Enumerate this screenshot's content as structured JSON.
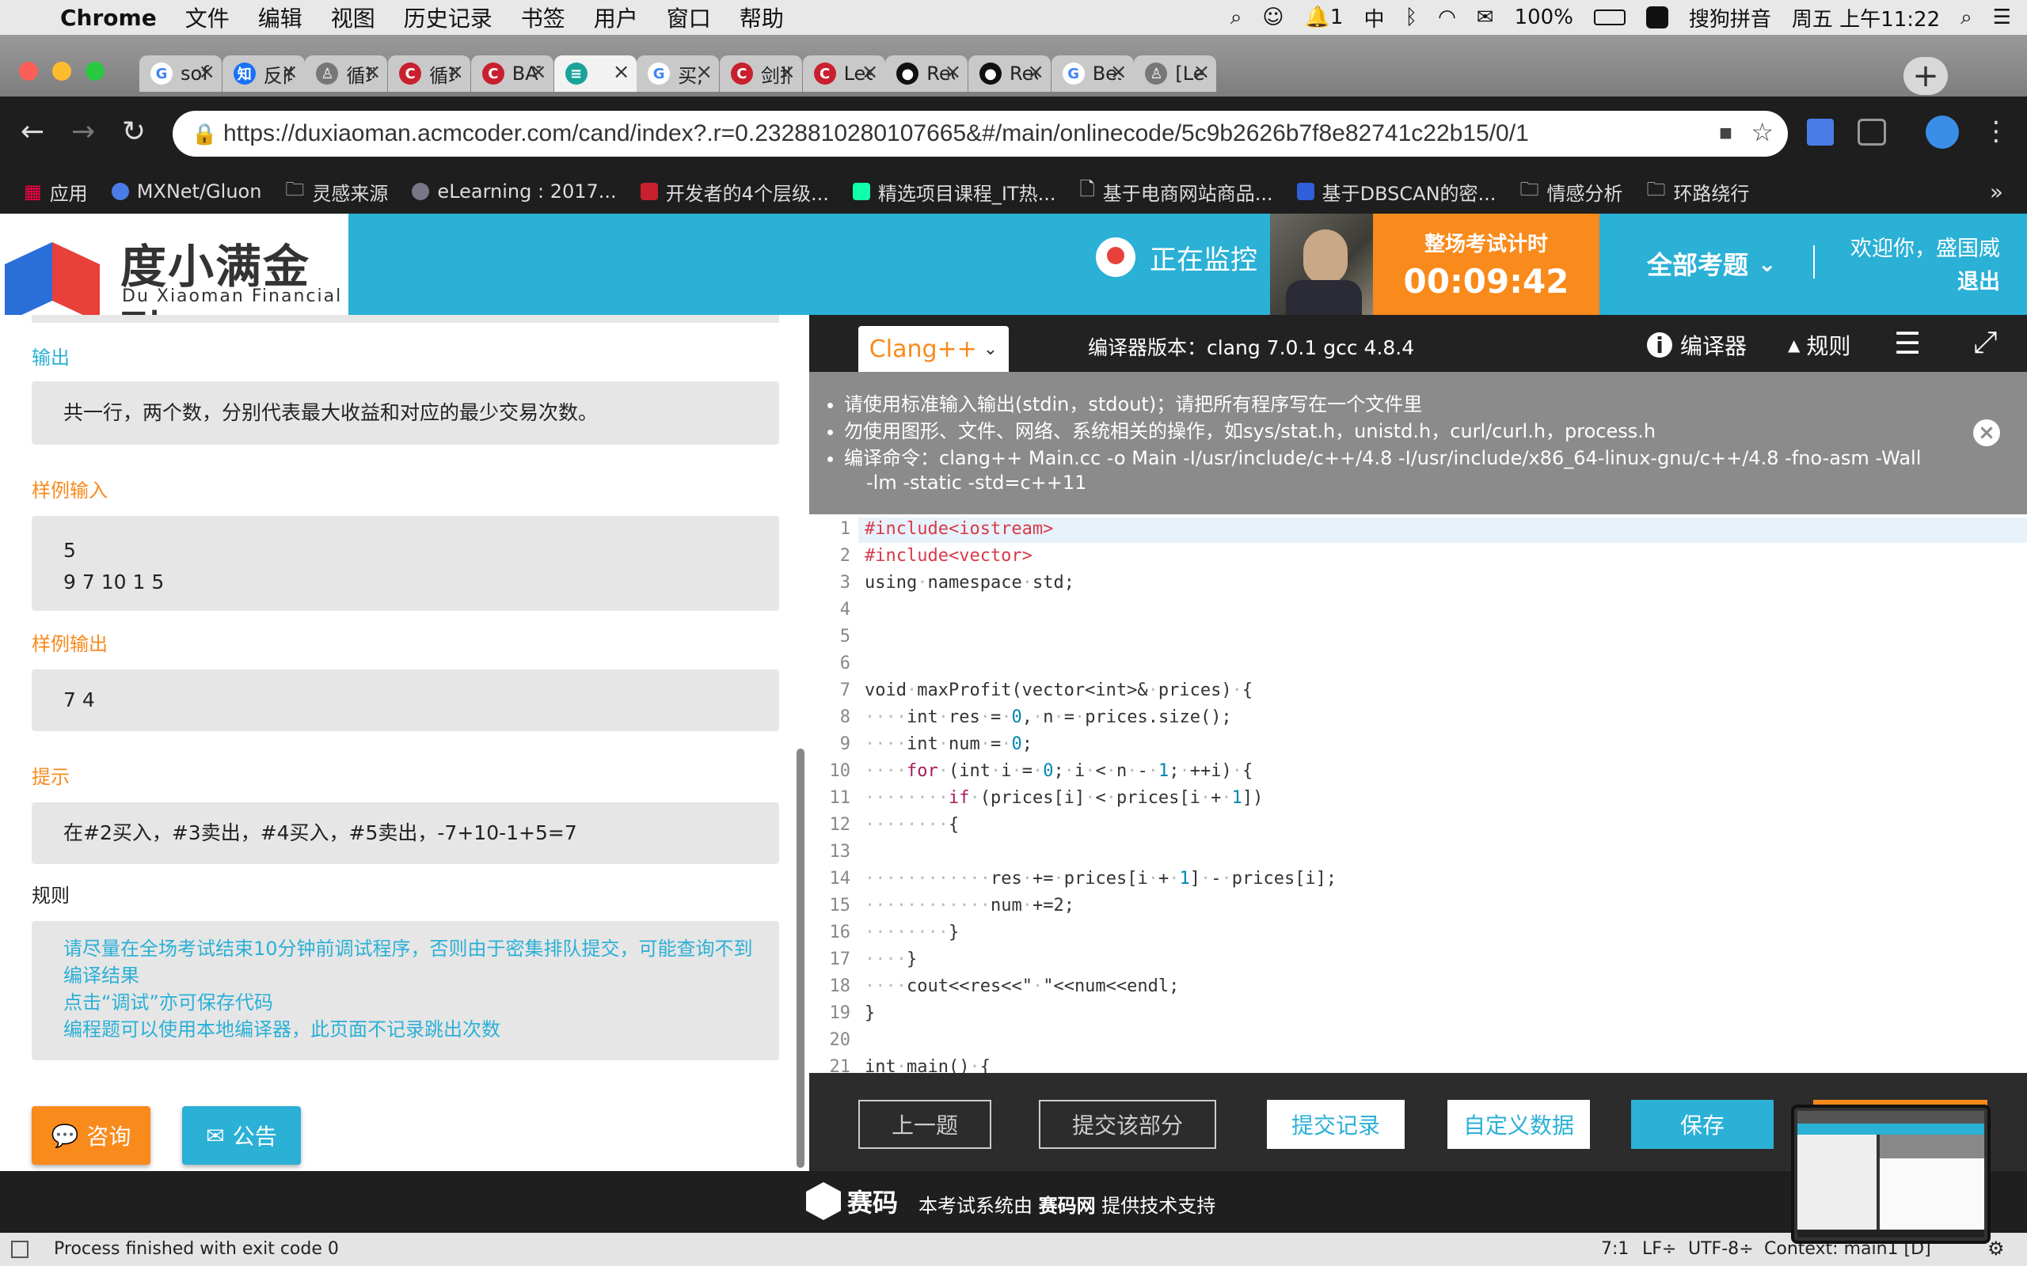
{
  "menubar": {
    "app": "Chrome",
    "items": [
      "文件",
      "编辑",
      "视图",
      "历史记录",
      "书签",
      "用户",
      "窗口",
      "帮助"
    ],
    "notif_count": "1",
    "ime": "中",
    "battery": "100%",
    "input_method": "搜狗拼音",
    "clock": "周五 上午11:22"
  },
  "tabs": [
    {
      "title": "soft",
      "icon": "google-icon"
    },
    {
      "title": "反向",
      "icon": "zhihu-icon"
    },
    {
      "title": "循环",
      "icon": "blog-icon"
    },
    {
      "title": "循环",
      "icon": "csdn-icon"
    },
    {
      "title": "BAT",
      "icon": "csdn-icon"
    },
    {
      "title": "",
      "icon": "acmcoder-icon"
    },
    {
      "title": "买,",
      "icon": "google-icon"
    },
    {
      "title": "剑指",
      "icon": "csdn-icon"
    },
    {
      "title": "Leet",
      "icon": "csdn-icon"
    },
    {
      "title": "Rec",
      "icon": "github-icon"
    },
    {
      "title": "Rec",
      "icon": "github-icon"
    },
    {
      "title": "Bes",
      "icon": "google-icon"
    },
    {
      "title": "[Lee",
      "icon": "blog-icon"
    }
  ],
  "url": "https://duxiaoman.acmcoder.com/cand/index?.r=0.2328810280107665&#/main/onlinecode/5c9b2626b7f8e82741c22b15/0/1",
  "bookmarks": [
    "应用",
    "MXNet/Gluon",
    "灵感来源",
    "eLearning : 2017...",
    "开发者的4个层级...",
    "精选项目课程_IT热...",
    "基于电商网站商品...",
    "基于DBSCAN的密...",
    "情感分析",
    "环路绕行"
  ],
  "bookmarks_more": "»",
  "header": {
    "logo_cn": "度小满金融",
    "logo_en": "Du Xiaoman Financial",
    "monitor": "正在监控",
    "timer_label": "整场考试计时",
    "timer": "00:09:42",
    "all_questions": "全部考题",
    "welcome": "欢迎你，盛国威",
    "logout": "退出"
  },
  "left": {
    "output_label": "输出",
    "output_text": "共一行，两个数，分别代表最大收益和对应的最少交易次数。",
    "sample_in_label": "样例输入",
    "sample_in_1": "5",
    "sample_in_2": "9 7 10 1 5",
    "sample_out_label": "样例输出",
    "sample_out": "7 4",
    "hint_label": "提示",
    "hint_text": "在#2买入，#3卖出，#4买入，#5卖出，-7+10-1+5=7",
    "rules_label": "规则",
    "rules": [
      "请尽量在全场考试结束10分钟前调试程序，否则由于密集排队提交，可能查询不到",
      "编译结果",
      "点击“调试”亦可保存代码",
      "编程题可以使用本地编译器，此页面不记录跳出次数"
    ],
    "consult_btn": "咨询",
    "notice_btn": "公告"
  },
  "editorbar": {
    "lang": "Clang++",
    "compiler_version": "编译器版本：clang 7.0.1 gcc 4.8.4",
    "compiler": "编译器",
    "rules": "规则"
  },
  "notice": [
    "请使用标准输入输出(stdin，stdout)；请把所有程序写在一个文件里",
    "勿使用图形、文件、网络、系统相关的操作，如sys/stat.h，unistd.h，curl/curl.h，process.h",
    "编译命令：clang++ Main.cc -o Main -I/usr/include/c++/4.8 -I/usr/include/x86_64-linux-gnu/c++/4.8 -fno-asm -Wall",
    "-lm -static -std=c++11"
  ],
  "code_lines": [
    "#include<iostream>",
    "#include<vector>",
    "using·namespace·std;",
    "",
    "",
    "",
    "void·maxProfit(vector<int>&·prices)·{",
    "····int·res·=·0,·n·=·prices.size();",
    "····int·num·=·0;",
    "····for·(int·i·=·0;·i·<·n·-·1;·++i)·{",
    "········if·(prices[i]·<·prices[i·+·1])",
    "········{",
    "",
    "············res·+=·prices[i·+·1]·-·prices[i];",
    "············num·+=2;",
    "········}",
    "····}",
    "····cout<<res<<\"·\"<<num<<endl;",
    "}",
    "",
    "int·main()·{"
  ],
  "actions": {
    "prev": "上一题",
    "submit_part": "提交该部分",
    "history": "提交记录",
    "custom_data": "自定义数据",
    "save": "保存"
  },
  "footer": {
    "brand": "赛码",
    "text_pre": "本考试系统由",
    "text_brand": "赛码网",
    "text_post": "提供技术支持"
  },
  "statusbar": {
    "message": "Process finished with exit code 0",
    "position": "7:1",
    "line_ending": "LF÷",
    "encoding": "UTF-8÷",
    "context": "Context: main1 [D]"
  },
  "colors": {
    "accent": "#2bb0d6",
    "orange": "#f98a1c",
    "dark": "#222222"
  }
}
